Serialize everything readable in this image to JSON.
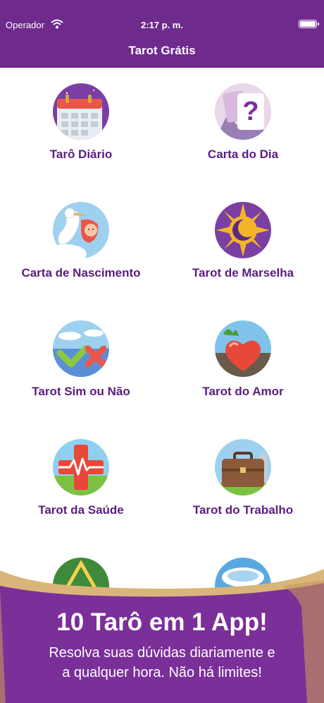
{
  "status": {
    "carrier": "Operador",
    "time": "2:17 p. m."
  },
  "nav": {
    "title": "Tarot Grátis"
  },
  "items": [
    {
      "label": "Tarô Diário",
      "icon": "calendar-icon"
    },
    {
      "label": "Carta do Dia",
      "icon": "question-card-icon"
    },
    {
      "label": "Carta de Nascimento",
      "icon": "stork-baby-icon"
    },
    {
      "label": "Tarot de Marselha",
      "icon": "sun-moon-icon"
    },
    {
      "label": "Tarot Sim ou Não",
      "icon": "check-cross-icon"
    },
    {
      "label": "Tarot do Amor",
      "icon": "heart-icon"
    },
    {
      "label": "Tarot da Saúde",
      "icon": "health-cross-icon"
    },
    {
      "label": "Tarot do Trabalho",
      "icon": "briefcase-icon"
    }
  ],
  "banner": {
    "headline": "10 Tarô em 1 App!",
    "line1": "Resolva suas dúvidas diariamente e",
    "line2": "a qualquer hora. Não há limites!"
  },
  "colors": {
    "brand": "#6e2a8d",
    "label": "#5b1c80"
  }
}
